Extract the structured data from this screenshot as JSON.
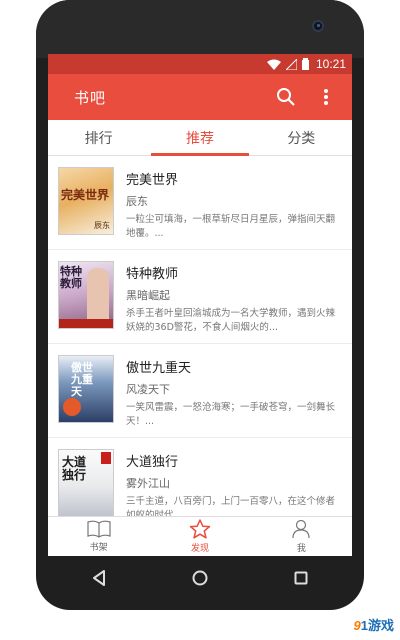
{
  "status_bar": {
    "time": "10:21"
  },
  "action_bar": {
    "title": "书吧"
  },
  "tabs": [
    {
      "label": "排行",
      "active": false
    },
    {
      "label": "推荐",
      "active": true
    },
    {
      "label": "分类",
      "active": false
    }
  ],
  "books": [
    {
      "title": "完美世界",
      "author": "辰东",
      "description": "一粒尘可填海，一根草斩尽日月星辰，弹指间天翻地覆。...",
      "cover_text": "完美世界",
      "cover_author": "辰东"
    },
    {
      "title": "特种教师",
      "author": "黑暗崛起",
      "description": "杀手王者叶皇回渝城成为一名大学教师，遇到火辣妖娆的36D警花，不食人间烟火的...",
      "cover_text": "特种教师"
    },
    {
      "title": "傲世九重天",
      "author": "风凌天下",
      "description": "一笑风雷震，一怒沧海寒；一手破苍穹，一剑舞长天！...",
      "cover_text": "傲世九重天"
    },
    {
      "title": "大道独行",
      "author": "雾外江山",
      "description": "三千主道，八百旁门，上门一百零八，在这个修者如蚁的时代...",
      "cover_text": "大道独行"
    }
  ],
  "bottom_nav": [
    {
      "label": "书架",
      "icon": "book-icon",
      "active": false
    },
    {
      "label": "发现",
      "icon": "star-icon",
      "active": true
    },
    {
      "label": "我",
      "icon": "person-icon",
      "active": false
    }
  ],
  "watermark": {
    "num": "9",
    "text": "1游戏"
  },
  "colors": {
    "accent": "#e84d3d",
    "status_bar": "#c73a30"
  }
}
